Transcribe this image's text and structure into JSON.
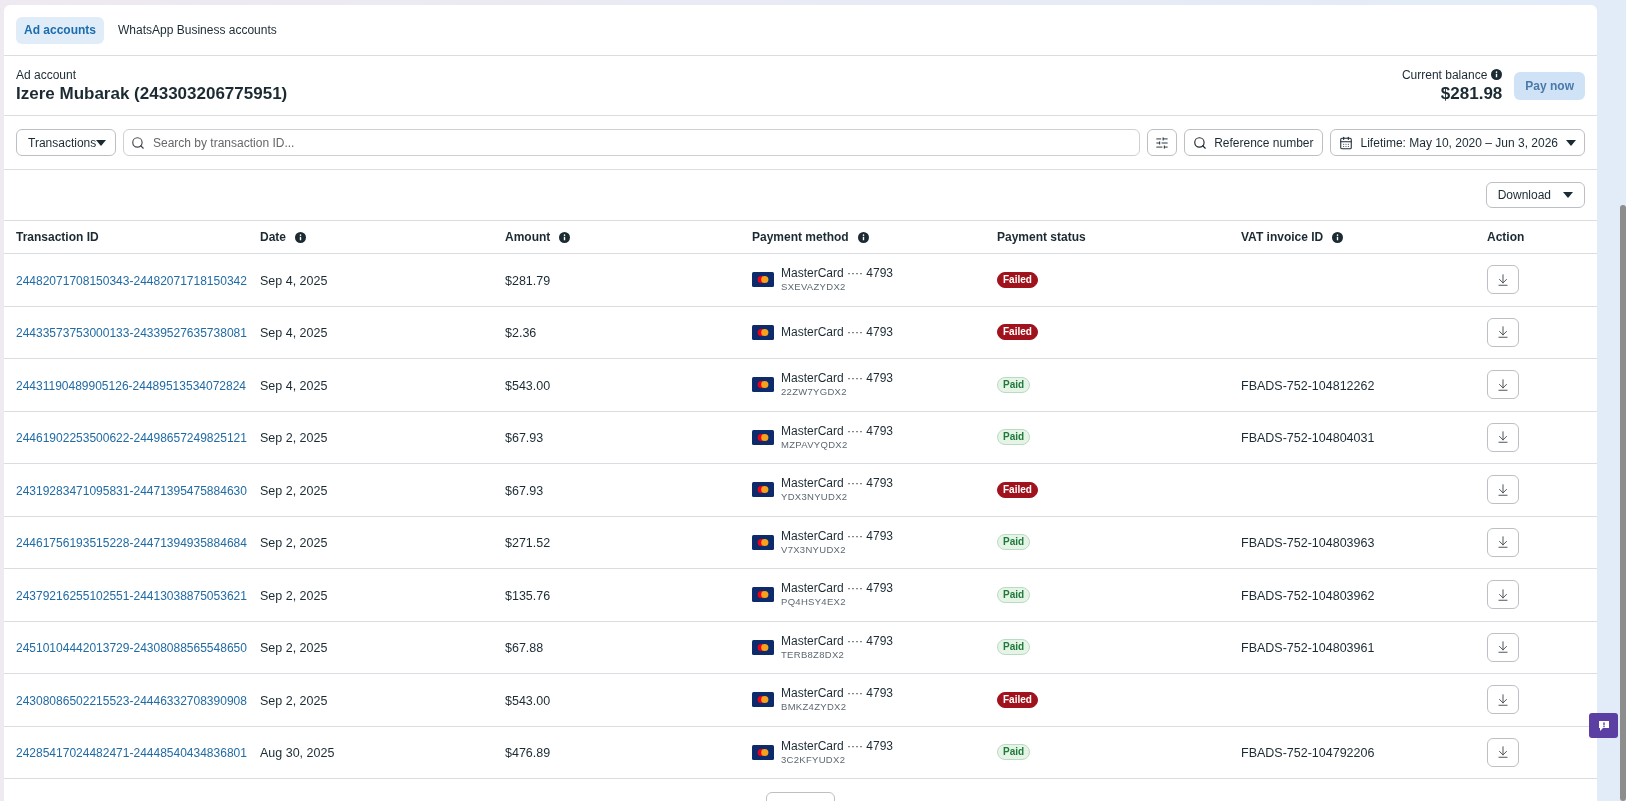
{
  "tabs": [
    {
      "label": "Ad accounts",
      "selected": true
    },
    {
      "label": "WhatsApp Business accounts",
      "selected": false
    }
  ],
  "account": {
    "label": "Ad account",
    "name": "Izere Mubarak (243303206775951)"
  },
  "balance": {
    "label": "Current balance",
    "info_icon": true,
    "amount": "$281.98",
    "pay_button": {
      "label": "Pay now",
      "disabled": true
    }
  },
  "filters": {
    "type_dropdown": {
      "label": "Transactions"
    },
    "search": {
      "placeholder": "Search by transaction ID..."
    },
    "reference_button": {
      "label": "Reference number"
    },
    "date_range": {
      "label": "Lifetime: May 10, 2020 – Jun 3, 2026"
    }
  },
  "toolbar": {
    "download_button": {
      "label": "Download"
    }
  },
  "table": {
    "columns": [
      {
        "label": "Transaction ID",
        "info_icon": false
      },
      {
        "label": "Date",
        "info_icon": true
      },
      {
        "label": "Amount",
        "info_icon": true
      },
      {
        "label": "Payment method",
        "info_icon": true
      },
      {
        "label": "Payment status",
        "info_icon": false
      },
      {
        "label": "VAT invoice ID",
        "info_icon": true
      },
      {
        "label": "Action",
        "info_icon": false
      }
    ],
    "rows": [
      {
        "transaction_id": "24482071708150343-24482071718150342",
        "date": "Sep 4, 2025",
        "amount": "$281.79",
        "payment_method": {
          "card": "MasterCard ···· 4793",
          "reference": "SXEVAZYDX2"
        },
        "status": {
          "kind": "failed",
          "label": "Failed"
        }
      },
      {
        "transaction_id": "24433573753000133-24339527635738081",
        "date": "Sep 4, 2025",
        "amount": "$2.36",
        "payment_method": {
          "card": "MasterCard ···· 4793"
        },
        "status": {
          "kind": "failed",
          "label": "Failed"
        }
      },
      {
        "transaction_id": "24431190489905126-24489513534072824",
        "date": "Sep 4, 2025",
        "amount": "$543.00",
        "payment_method": {
          "card": "MasterCard ···· 4793",
          "reference": "22ZW7YGDX2"
        },
        "status": {
          "kind": "paid",
          "label": "Paid"
        },
        "vat_invoice_id": "FBADS-752-104812262"
      },
      {
        "transaction_id": "24461902253500622-24498657249825121",
        "date": "Sep 2, 2025",
        "amount": "$67.93",
        "payment_method": {
          "card": "MasterCard ···· 4793",
          "reference": "MZPAVYQDX2"
        },
        "status": {
          "kind": "paid",
          "label": "Paid"
        },
        "vat_invoice_id": "FBADS-752-104804031"
      },
      {
        "transaction_id": "24319283471095831-24471395475884630",
        "date": "Sep 2, 2025",
        "amount": "$67.93",
        "payment_method": {
          "card": "MasterCard ···· 4793",
          "reference": "YDX3NYUDX2"
        },
        "status": {
          "kind": "failed",
          "label": "Failed"
        }
      },
      {
        "transaction_id": "24461756193515228-24471394935884684",
        "date": "Sep 2, 2025",
        "amount": "$271.52",
        "payment_method": {
          "card": "MasterCard ···· 4793",
          "reference": "V7X3NYUDX2"
        },
        "status": {
          "kind": "paid",
          "label": "Paid"
        },
        "vat_invoice_id": "FBADS-752-104803963"
      },
      {
        "transaction_id": "24379216255102551-24413038875053621",
        "date": "Sep 2, 2025",
        "amount": "$135.76",
        "payment_method": {
          "card": "MasterCard ···· 4793",
          "reference": "PQ4HSY4EX2"
        },
        "status": {
          "kind": "paid",
          "label": "Paid"
        },
        "vat_invoice_id": "FBADS-752-104803962"
      },
      {
        "transaction_id": "24510104442013729-24308088565548650",
        "date": "Sep 2, 2025",
        "amount": "$67.88",
        "payment_method": {
          "card": "MasterCard ···· 4793",
          "reference": "TERB8Z8DX2"
        },
        "status": {
          "kind": "paid",
          "label": "Paid"
        },
        "vat_invoice_id": "FBADS-752-104803961"
      },
      {
        "transaction_id": "24308086502215523-24446332708390908",
        "date": "Sep 2, 2025",
        "amount": "$543.00",
        "payment_method": {
          "card": "MasterCard ···· 4793",
          "reference": "BMKZ4ZYDX2"
        },
        "status": {
          "kind": "failed",
          "label": "Failed"
        }
      },
      {
        "transaction_id": "24285417024482471-24448540434836801",
        "date": "Aug 30, 2025",
        "amount": "$476.89",
        "payment_method": {
          "card": "MasterCard ···· 4793",
          "reference": "3C2KFYUDX2"
        },
        "status": {
          "kind": "paid",
          "label": "Paid"
        },
        "vat_invoice_id": "FBADS-752-104792206"
      }
    ]
  }
}
